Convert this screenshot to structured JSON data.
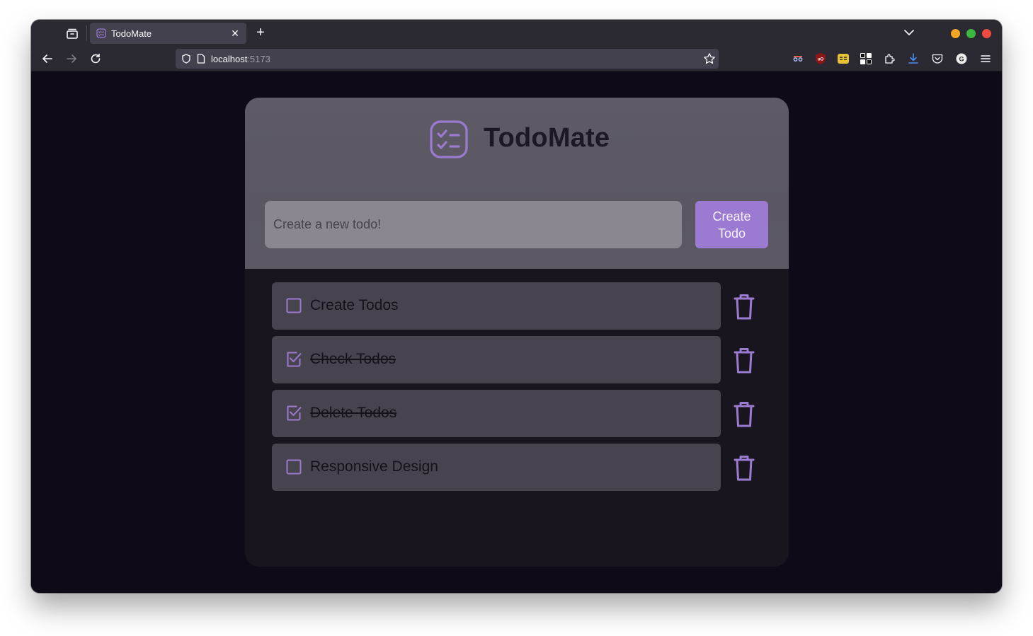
{
  "browser": {
    "tab_title": "TodoMate",
    "url_host": "localhost",
    "url_port": ":5173"
  },
  "app": {
    "title": "TodoMate",
    "accent_color": "#9b7bd1",
    "input_placeholder": "Create a new todo!",
    "input_value": "",
    "create_button_label": "Create Todo"
  },
  "todos": [
    {
      "text": "Create Todos",
      "done": false
    },
    {
      "text": "Check Todos",
      "done": true
    },
    {
      "text": "Delete Todos",
      "done": true
    },
    {
      "text": "Responsive Design",
      "done": false
    }
  ]
}
